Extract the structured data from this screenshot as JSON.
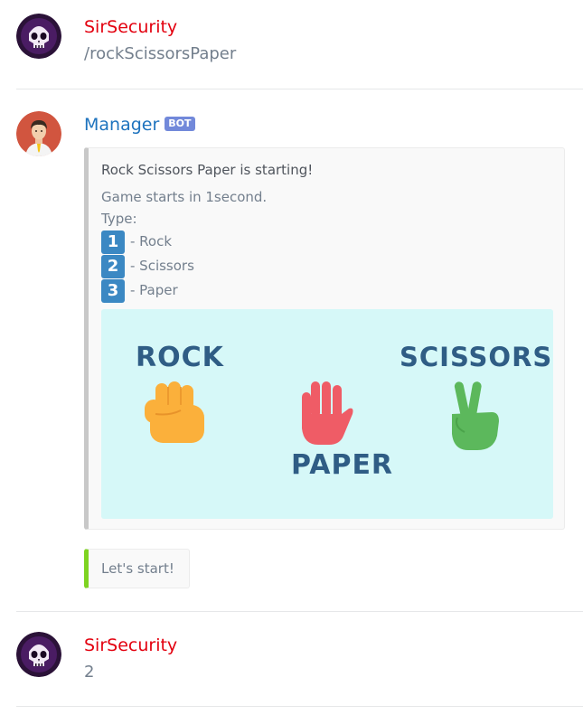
{
  "messages": [
    {
      "author": "SirSecurity",
      "author_color": "#e3000f",
      "text": "/rockScissorsPaper"
    },
    {
      "author": "Manager",
      "badge": "BOT",
      "author_color": "#1e73be"
    },
    {
      "author": "SirSecurity",
      "author_color": "#e3000f",
      "text": "2"
    }
  ],
  "embed": {
    "title": "Rock Scissors Paper is starting!",
    "line1": "Game starts in 1second.",
    "line2": "Type:",
    "options": [
      {
        "key": "1",
        "label": "- Rock"
      },
      {
        "key": "2",
        "label": "- Scissors"
      },
      {
        "key": "3",
        "label": "- Paper"
      }
    ],
    "image": {
      "rock": "ROCK",
      "paper": "PAPER",
      "scissors": "SCISSORS"
    }
  },
  "followup": {
    "text": "Let's start!"
  }
}
